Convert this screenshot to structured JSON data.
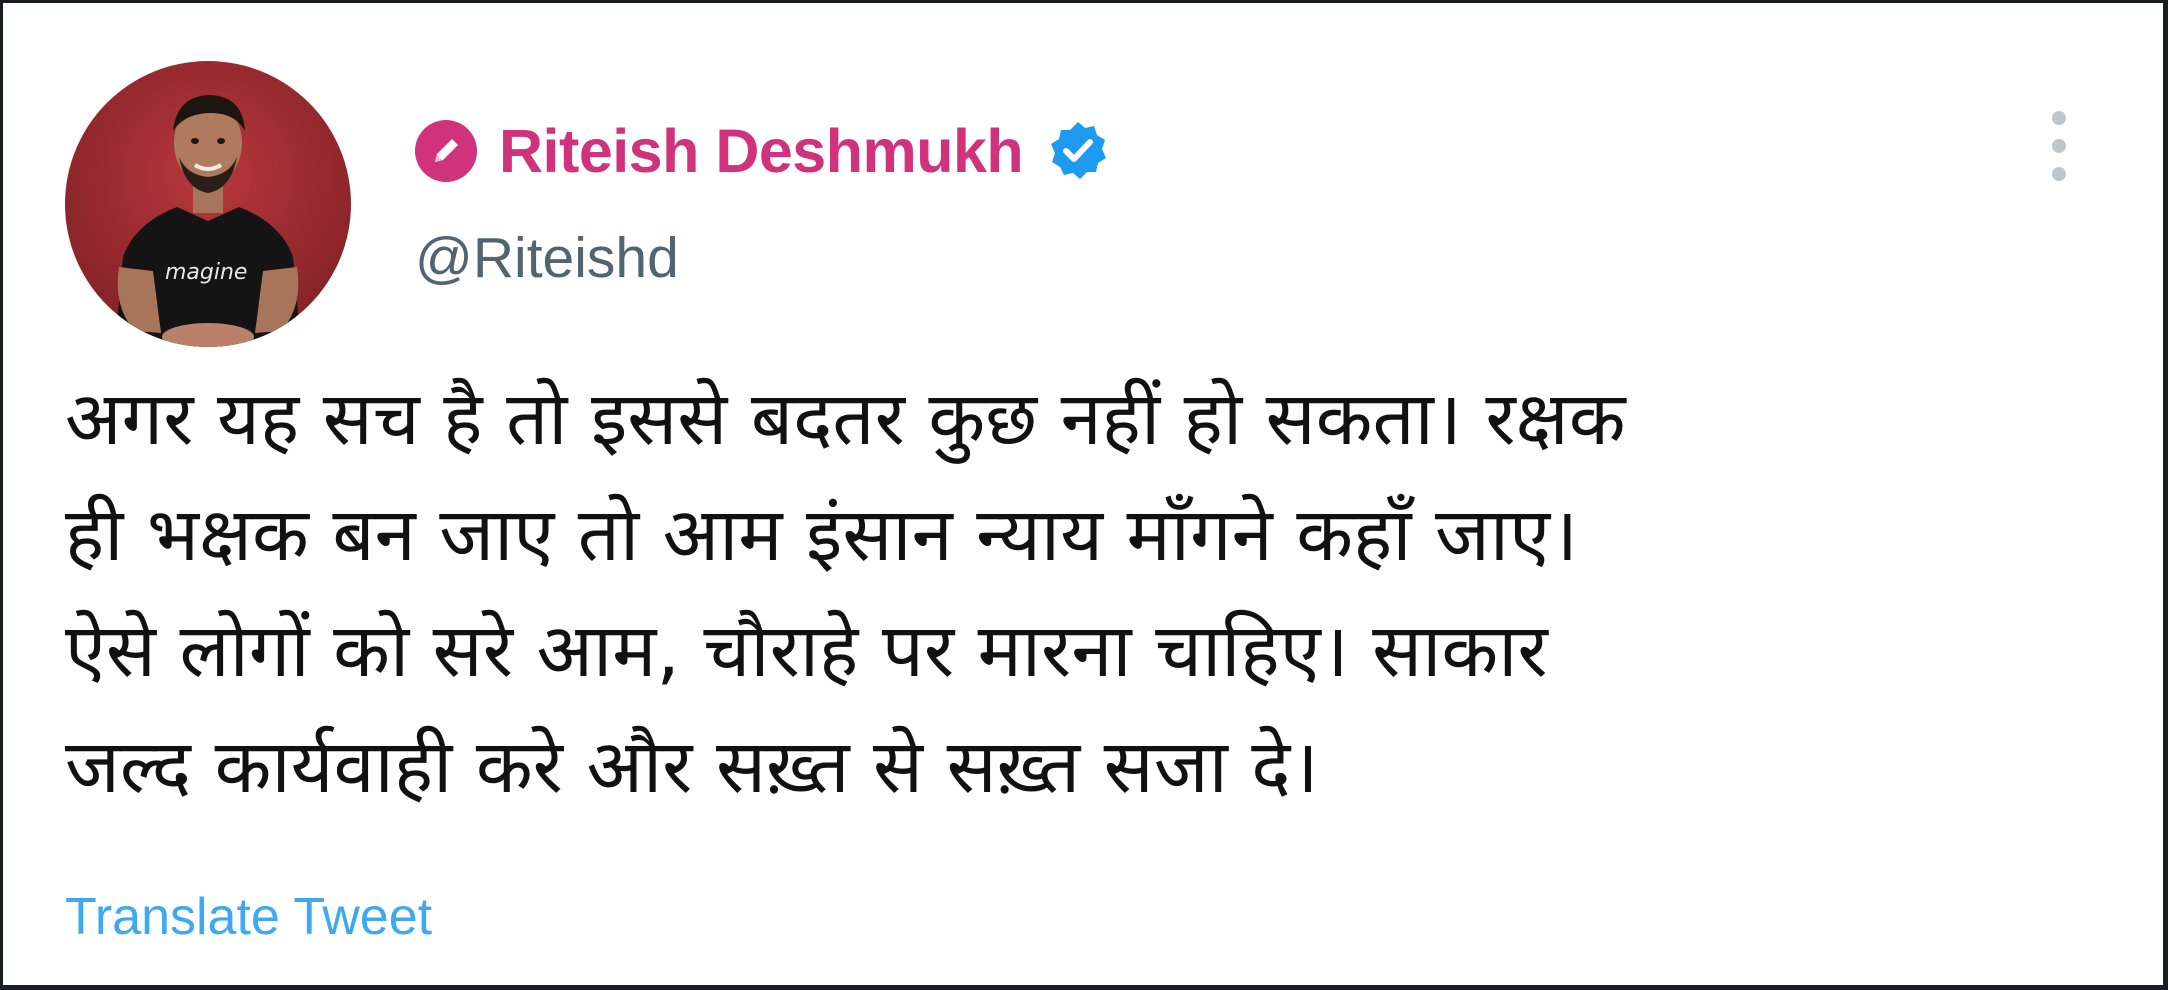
{
  "tweet": {
    "author": {
      "display_name": "Riteish Deshmukh",
      "handle": "@Riteishd",
      "avatar_shirt_text": "magine",
      "name_icon": "pencil-badge-icon",
      "verified_icon": "verified-badge-icon"
    },
    "menu_icon": "more-options-icon",
    "text_lines": [
      "अगर यह सच है तो इससे बदतर कुछ नहीं हो सकता। रक्षक",
      "ही भक्षक बन जाए तो आम इंसान न्याय माँगने कहाँ जाए।",
      "ऐसे लोगों को सरे आम, चौराहे पर मारना चाहिए। साकार",
      "जल्द कार्यवाही करे और सख़्त से सख़्त सजा दे।"
    ],
    "translate_label": "Translate Tweet"
  },
  "colors": {
    "name": "#d0327c",
    "handle": "#536471",
    "link": "#1d9bf0",
    "verified": "#1d9bf0",
    "avatar_background": "#9a2a2e"
  }
}
